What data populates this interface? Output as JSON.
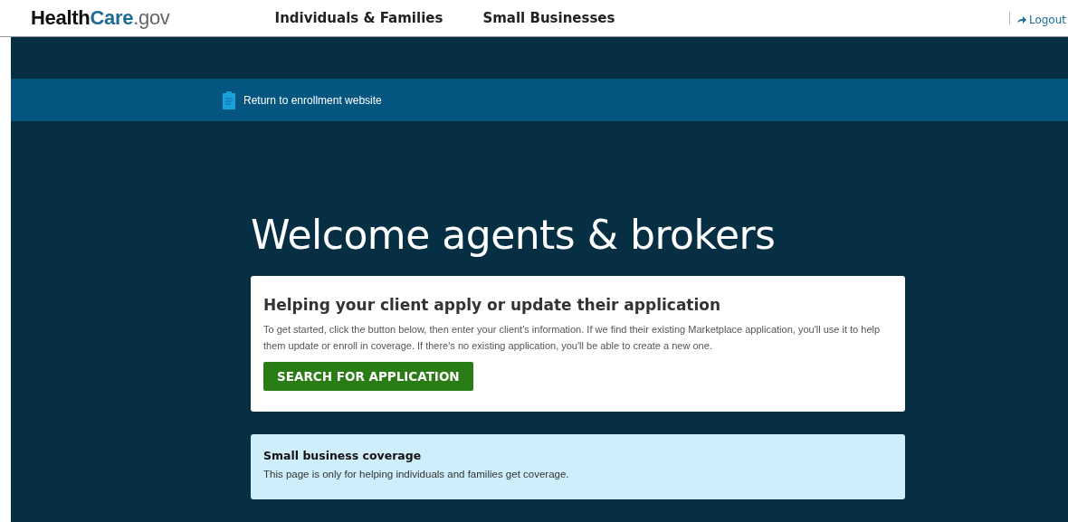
{
  "header": {
    "logo": [
      {
        "text": "Health",
        "kind": "dark"
      },
      {
        "text": "Care",
        "kind": "accent"
      },
      {
        "text": ".gov",
        "kind": "light"
      }
    ],
    "nav": [
      {
        "label": "Individuals & Families"
      },
      {
        "label": "Small Businesses"
      }
    ],
    "logout": "Logout"
  },
  "return_link": "Return to enrollment website",
  "title": "Welcome agents & brokers",
  "card": {
    "heading": "Helping your client apply or update their application",
    "text": "To get started, click the button below, then enter your client's information. If we find their existing Marketplace application, you'll use it to help them update or enroll in coverage. If there's no existing application, you'll be able to create a new one.",
    "button": "SEARCH FOR APPLICATION"
  },
  "notice": {
    "heading": "Small business coverage",
    "text": "This page is only for helping individuals and families get coverage."
  }
}
